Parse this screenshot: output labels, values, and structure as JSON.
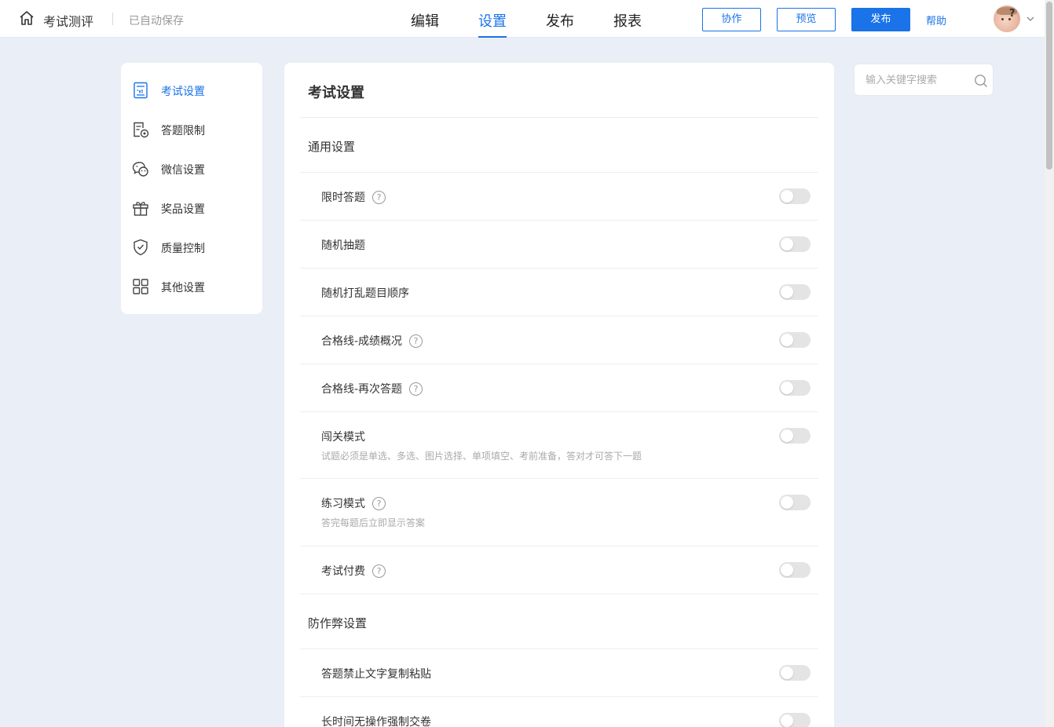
{
  "header": {
    "app_title": "考试测评",
    "save_status": "已自动保存",
    "tabs": [
      {
        "label": "编辑",
        "active": false
      },
      {
        "label": "设置",
        "active": true
      },
      {
        "label": "发布",
        "active": false
      },
      {
        "label": "报表",
        "active": false
      }
    ],
    "collab_label": "协作",
    "preview_label": "预览",
    "publish_label": "发布",
    "help_label": "帮助"
  },
  "sidebar": {
    "items": [
      {
        "label": "考试设置",
        "icon": "exam-paper-icon",
        "active": true
      },
      {
        "label": "答题限制",
        "icon": "answer-limit-icon",
        "active": false
      },
      {
        "label": "微信设置",
        "icon": "wechat-icon",
        "active": false
      },
      {
        "label": "奖品设置",
        "icon": "gift-icon",
        "active": false
      },
      {
        "label": "质量控制",
        "icon": "shield-check-icon",
        "active": false
      },
      {
        "label": "其他设置",
        "icon": "grid-icon",
        "active": false
      }
    ]
  },
  "main": {
    "title": "考试设置",
    "sections": [
      {
        "title": "通用设置",
        "rows": [
          {
            "label": "限时答题",
            "help": true,
            "desc": "",
            "enabled": false
          },
          {
            "label": "随机抽题",
            "help": false,
            "desc": "",
            "enabled": false
          },
          {
            "label": "随机打乱题目顺序",
            "help": false,
            "desc": "",
            "enabled": false
          },
          {
            "label": "合格线-成绩概况",
            "help": true,
            "desc": "",
            "enabled": false
          },
          {
            "label": "合格线-再次答题",
            "help": true,
            "desc": "",
            "enabled": false
          },
          {
            "label": "闯关模式",
            "help": false,
            "desc": "试题必须是单选、多选、图片选择、单项填空、考前准备，答对才可答下一题",
            "enabled": false
          },
          {
            "label": "练习模式",
            "help": true,
            "desc": "答完每题后立即显示答案",
            "enabled": false
          },
          {
            "label": "考试付费",
            "help": true,
            "desc": "",
            "enabled": false
          }
        ]
      },
      {
        "title": "防作弊设置",
        "rows": [
          {
            "label": "答题禁止文字复制粘贴",
            "help": false,
            "desc": "",
            "enabled": false
          },
          {
            "label": "长时间无操作强制交卷",
            "help": false,
            "desc": "",
            "enabled": false
          }
        ]
      }
    ]
  },
  "search": {
    "placeholder": "输入关键字搜索",
    "value": ""
  },
  "help_glyph": "?",
  "colors": {
    "accent": "#1a73e8",
    "background": "#eaeef7",
    "toggle_off": "#e4e4e4"
  }
}
